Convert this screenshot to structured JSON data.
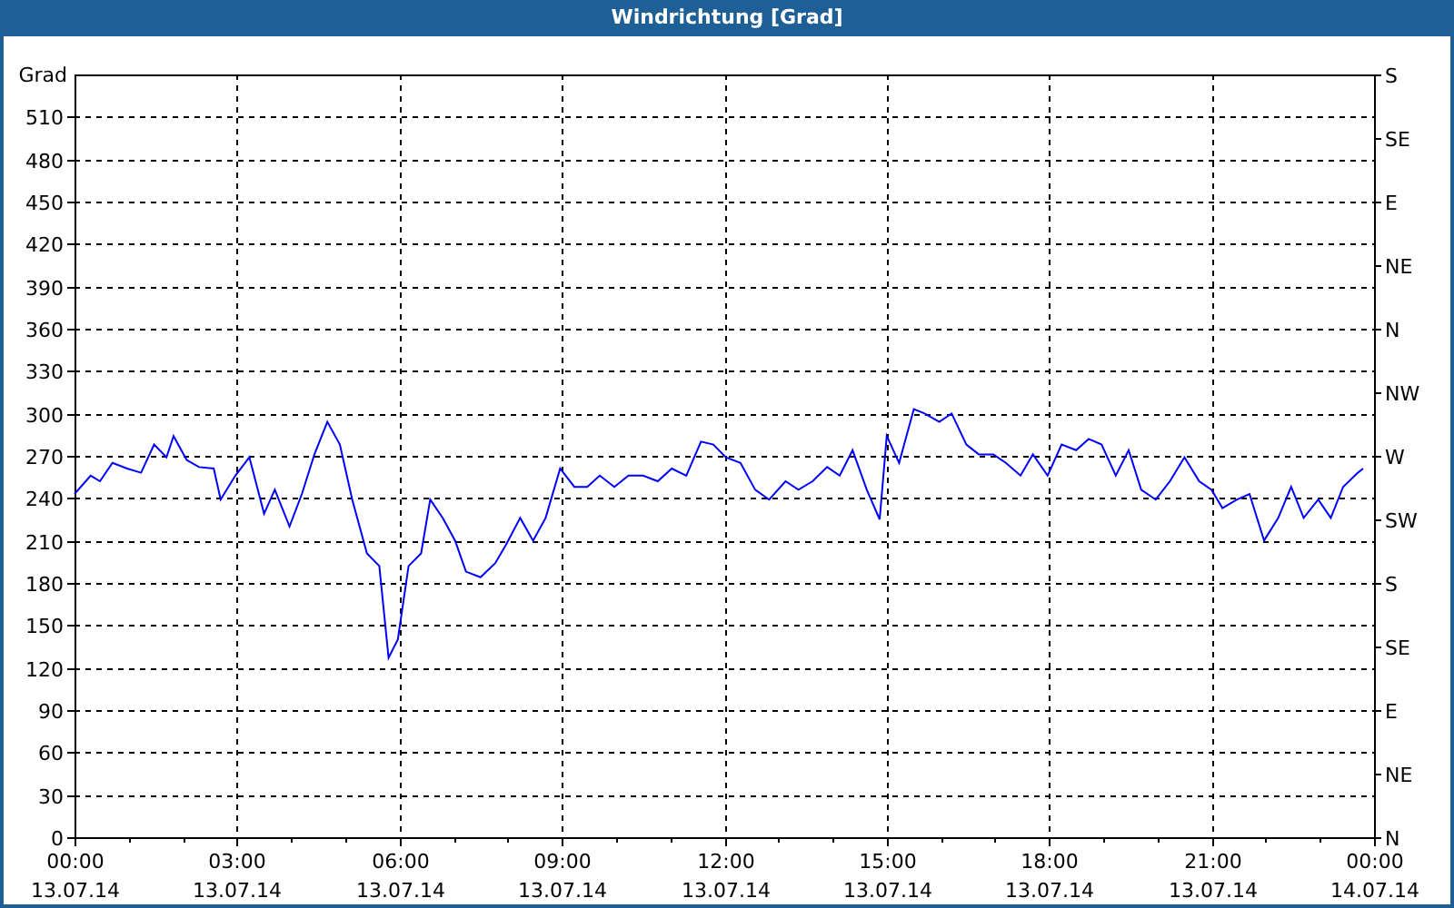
{
  "window": {
    "title": "Windrichtung [Grad]"
  },
  "chart": {
    "chart_data": {
      "type": "line",
      "ylabel": "Grad",
      "grid": true,
      "xlim": [
        0,
        24
      ],
      "ylim": [
        0,
        540
      ],
      "xticks": [
        {
          "value": 0,
          "label": "00:00"
        },
        {
          "value": 3,
          "label": "03:00"
        },
        {
          "value": 6,
          "label": "06:00"
        },
        {
          "value": 9,
          "label": "09:00"
        },
        {
          "value": 12,
          "label": "12:00"
        },
        {
          "value": 15,
          "label": "15:00"
        },
        {
          "value": 18,
          "label": "18:00"
        },
        {
          "value": 21,
          "label": "21:00"
        },
        {
          "value": 24,
          "label": "00:00"
        }
      ],
      "yticks": [
        0,
        30,
        60,
        90,
        120,
        150,
        180,
        210,
        240,
        270,
        300,
        330,
        360,
        390,
        420,
        450,
        480,
        510
      ],
      "x": [
        0,
        0.3,
        0.47,
        0.7,
        0.97,
        1.23,
        1.47,
        1.7,
        1.83,
        2.07,
        2.3,
        2.57,
        2.7,
        2.97,
        3.23,
        3.5,
        3.7,
        3.97,
        4.2,
        4.43,
        4.67,
        4.9,
        5.13,
        5.4,
        5.63,
        5.8,
        5.97,
        6.17,
        6.4,
        6.57,
        6.8,
        7.03,
        7.23,
        7.5,
        7.77,
        7.97,
        8.23,
        8.47,
        8.7,
        8.97,
        9.23,
        9.47,
        9.7,
        9.97,
        10.23,
        10.5,
        10.77,
        11.03,
        11.3,
        11.57,
        11.8,
        12.03,
        12.3,
        12.57,
        12.83,
        13.13,
        13.37,
        13.63,
        13.9,
        14.13,
        14.37,
        14.63,
        14.87,
        15,
        15.23,
        15.5,
        15.7,
        15.97,
        16.2,
        16.47,
        16.7,
        16.97,
        17.2,
        17.47,
        17.7,
        17.97,
        18.23,
        18.5,
        18.73,
        18.97,
        19.23,
        19.47,
        19.7,
        19.97,
        20.23,
        20.5,
        20.77,
        21,
        21.2,
        21.47,
        21.7,
        21.97,
        22.23,
        22.47,
        22.7,
        22.97,
        23.2,
        23.43,
        23.7,
        23.8
      ],
      "series": [
        {
          "color": "#0000ff",
          "values": [
            243,
            256,
            252,
            265,
            261,
            258,
            278,
            269,
            284,
            267,
            262,
            261,
            239,
            256,
            269,
            229,
            246,
            220,
            243,
            271,
            294,
            278,
            239,
            201,
            192,
            127,
            140,
            192,
            201,
            239,
            226,
            210,
            188,
            184,
            194,
            207,
            226,
            210,
            226,
            261,
            248,
            248,
            256,
            248,
            256,
            256,
            252,
            261,
            256,
            280,
            278,
            269,
            265,
            246,
            239,
            252,
            246,
            252,
            262,
            256,
            274,
            246,
            225,
            284,
            265,
            303,
            300,
            294,
            300,
            278,
            271,
            271,
            265,
            256,
            271,
            256,
            278,
            274,
            282,
            278,
            256,
            274,
            246,
            239,
            252,
            269,
            252,
            246,
            233,
            239,
            243,
            210,
            226,
            248,
            226,
            239,
            226,
            248,
            258,
            261
          ]
        }
      ]
    },
    "date_labels": [
      "13.07.14",
      "13.07.14",
      "13.07.14",
      "13.07.14",
      "13.07.14",
      "13.07.14",
      "13.07.14",
      "13.07.14",
      "14.07.14"
    ],
    "compass_labels": [
      "S",
      "SE",
      "E",
      "NE",
      "N",
      "NW",
      "W",
      "SW",
      "S",
      "SE",
      "E",
      "NE",
      "N"
    ]
  }
}
